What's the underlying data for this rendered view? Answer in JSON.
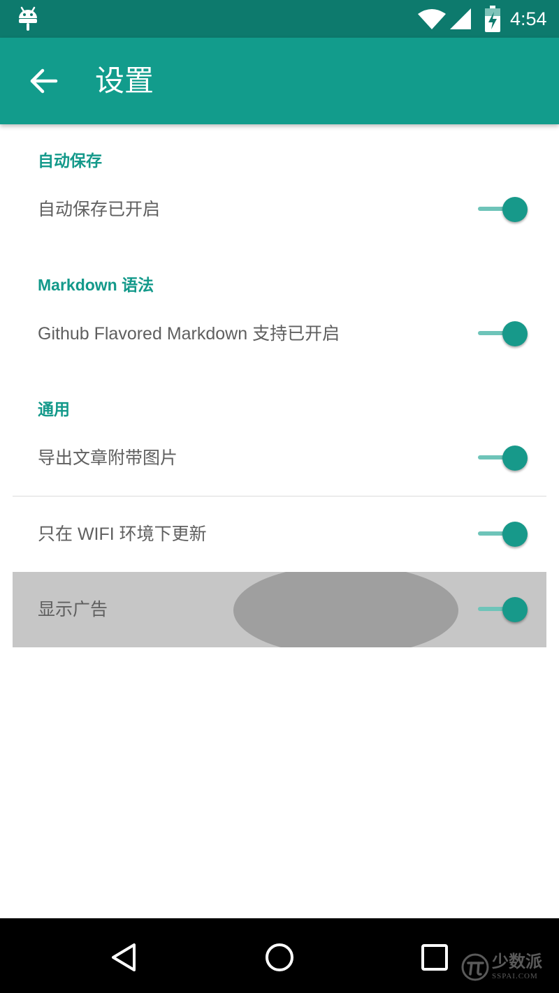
{
  "status_bar": {
    "time": "4:54",
    "icons": [
      "android-icon",
      "wifi-icon",
      "signal-icon",
      "battery-charging-icon"
    ]
  },
  "toolbar": {
    "title": "设置",
    "back_icon": "arrow-left-icon"
  },
  "sections": [
    {
      "header": "自动保存",
      "items": [
        {
          "label": "自动保存已开启",
          "checked": true
        }
      ]
    },
    {
      "header": "Markdown 语法",
      "items": [
        {
          "label": "Github Flavored Markdown 支持已开启",
          "checked": true
        }
      ]
    },
    {
      "header": "通用",
      "items": [
        {
          "label": "导出文章附带图片",
          "checked": true
        },
        {
          "label": "只在 WIFI 环境下更新",
          "checked": true
        },
        {
          "label": "显示广告",
          "checked": true,
          "pressed": true
        }
      ]
    }
  ],
  "colors": {
    "status_bar": "#0d7a6d",
    "toolbar": "#129c8c",
    "accent": "#13998a",
    "switch_track": "#6ec4b9",
    "text": "#5f5f5f",
    "pressed_row": "#c6c6c6",
    "ripple": "#9f9f9f",
    "nav_bar": "#000000"
  },
  "nav_bar": {
    "icons": [
      "nav-back-icon",
      "nav-home-icon",
      "nav-recents-icon"
    ],
    "watermark": {
      "text": "少数派",
      "sub": "SSPAI.COM"
    }
  }
}
